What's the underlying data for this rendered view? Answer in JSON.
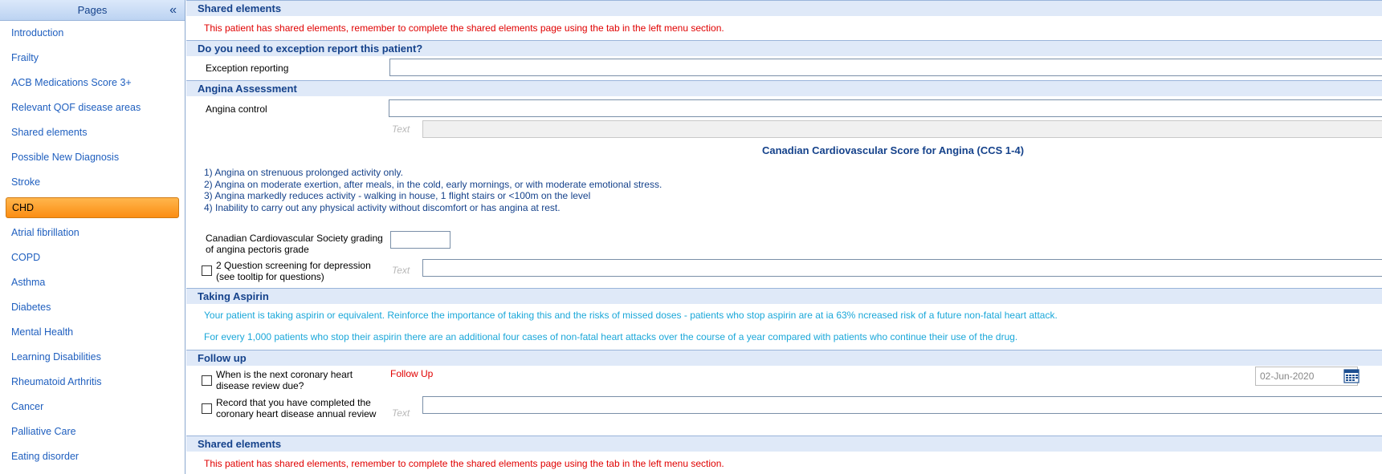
{
  "sidebar": {
    "title": "Pages",
    "collapse_glyph": "«",
    "items": [
      {
        "label": "Introduction"
      },
      {
        "label": "Frailty"
      },
      {
        "label": "ACB Medications Score 3+"
      },
      {
        "label": "Relevant QOF disease areas"
      },
      {
        "label": "Shared elements"
      },
      {
        "label": "Possible New Diagnosis"
      },
      {
        "label": "Stroke"
      },
      {
        "label": "CHD"
      },
      {
        "label": "Atrial fibrillation"
      },
      {
        "label": "COPD"
      },
      {
        "label": "Asthma"
      },
      {
        "label": "Diabetes"
      },
      {
        "label": "Mental Health"
      },
      {
        "label": "Learning Disabilities"
      },
      {
        "label": "Rheumatoid Arthritis"
      },
      {
        "label": "Cancer"
      },
      {
        "label": "Palliative Care"
      },
      {
        "label": "Eating disorder"
      }
    ],
    "active_item": "CHD"
  },
  "shared_top": {
    "header": "Shared elements",
    "message": "This patient has shared elements, remember to complete the shared elements page using the tab in the left menu section."
  },
  "exception": {
    "header": "Do you need to exception report this patient?",
    "label": "Exception reporting",
    "value": ""
  },
  "angina": {
    "header": "Angina Assessment",
    "control_label": "Angina control",
    "control_value": "",
    "text_placeholder": "Text",
    "ccs_title": "Canadian Cardiovascular Score for Angina (CCS 1-4)",
    "ccs_lines": [
      "1) Angina on strenuous prolonged activity only.",
      "2) Angina on moderate exertion, after meals, in the cold, early mornings, or with moderate emotional stress.",
      "3) Angina markedly reduces activity - walking in house, 1 flight stairs or  <100m on the level",
      "4) Inability to carry out any physical activity without discomfort or has angina at rest."
    ],
    "grading_label_1": "Canadian Cardiovascular Society grading",
    "grading_label_2": "of angina pectoris grade",
    "grading_value": "",
    "depression_label_1": "2 Question screening for depression",
    "depression_label_2": "(see tooltip for questions)",
    "depression_placeholder": "Text"
  },
  "aspirin": {
    "header": "Taking Aspirin",
    "line1": "Your patient is taking aspirin or equivalent.  Reinforce the importance of taking this and the risks of missed doses - patients who stop aspirin are at ia 63% ncreased risk of a future non-fatal heart attack.",
    "line2": "For every 1,000 patients who stop their aspirin there are an additional four cases of non-fatal heart attacks over the course of a year compared with patients who continue their use of the drug."
  },
  "followup": {
    "header": "Follow up",
    "review_label_1": "When is the next coronary heart",
    "review_label_2": "disease review due?",
    "followup_link": "Follow Up",
    "date_value": "02-Jun-2020",
    "record_label_1": "Record that you have completed the",
    "record_label_2": "coronary heart disease annual review",
    "record_placeholder": "Text"
  },
  "shared_bottom": {
    "header": "Shared elements",
    "message": "This patient has shared elements, remember to complete the shared elements page using the tab in the left menu section."
  },
  "colors": {
    "accent": "#15428b",
    "link": "#1f5fbf",
    "warning": "#e00000",
    "info": "#1aa7d9",
    "active": "#fb8d12"
  }
}
